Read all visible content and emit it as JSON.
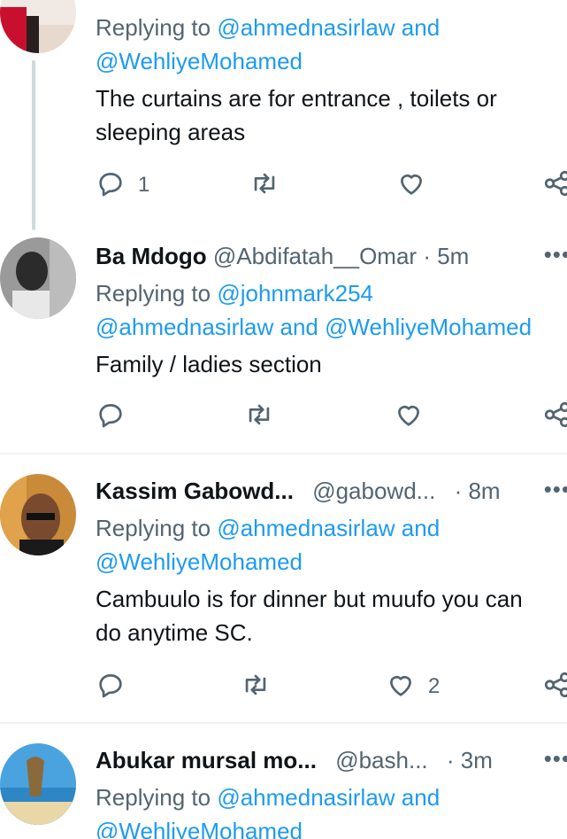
{
  "tweets": [
    {
      "name": "",
      "handle": "",
      "time": "",
      "replying_prefix": "Replying to",
      "replying_line1": "@ahmednasirlaw and",
      "replying_line2": "@WehliyeMohamed",
      "text_lines": [
        "The curtains are for entrance , toilets or",
        "sleeping areas"
      ],
      "reply_count": "1",
      "like_count": ""
    },
    {
      "name": "Ba Mdogo",
      "handle": "@Abdifatah__Omar",
      "separator": "·",
      "time": "5m",
      "replying_prefix": "Replying to",
      "replying_line1": "@johnmark254",
      "replying_line2": "@ahmednasirlaw and @WehliyeMohamed",
      "text_lines": [
        "Family / ladies section"
      ],
      "reply_count": "",
      "like_count": ""
    },
    {
      "name": "Kassim Gabowd...",
      "handle": "@gabowd...",
      "separator": "·",
      "time": "8m",
      "replying_prefix": "Replying to",
      "replying_line1": "@ahmednasirlaw and",
      "replying_line2": "@WehliyeMohamed",
      "text_lines": [
        "Cambuulo is for dinner but muufo you can",
        "do anytime SC."
      ],
      "reply_count": "",
      "like_count": "2"
    },
    {
      "name": "Abukar mursal mo...",
      "handle": "@bash...",
      "separator": "·",
      "time": "3m",
      "replying_prefix": "Replying to",
      "replying_line1": "@ahmednasirlaw and",
      "replying_line2": "@WehliyeMohamed",
      "text_lines": [],
      "reply_count": "",
      "like_count": ""
    }
  ],
  "more_icon": "more-horizontal-icon",
  "colors": {
    "link": "#1d9bf0",
    "muted": "#536471",
    "text": "#0f1419",
    "divider": "#eff3f4"
  }
}
